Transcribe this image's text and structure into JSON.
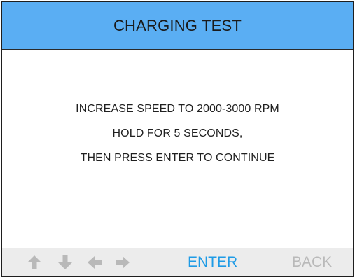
{
  "header": {
    "title": "CHARGING TEST"
  },
  "instructions": {
    "line1": "INCREASE SPEED TO 2000-3000 RPM",
    "line2": "HOLD FOR 5 SECONDS,",
    "line3": "THEN PRESS ENTER TO CONTINUE"
  },
  "footer": {
    "icons": [
      "arrow-up-icon",
      "arrow-down-icon",
      "arrow-left-icon",
      "arrow-right-icon"
    ],
    "enter_label": "ENTER",
    "back_label": "BACK"
  },
  "colors": {
    "header_bg": "#5aaef3",
    "enter": "#1e9be6",
    "back_disabled": "#b9b9b9",
    "arrows_disabled": "#b9b9b9"
  }
}
